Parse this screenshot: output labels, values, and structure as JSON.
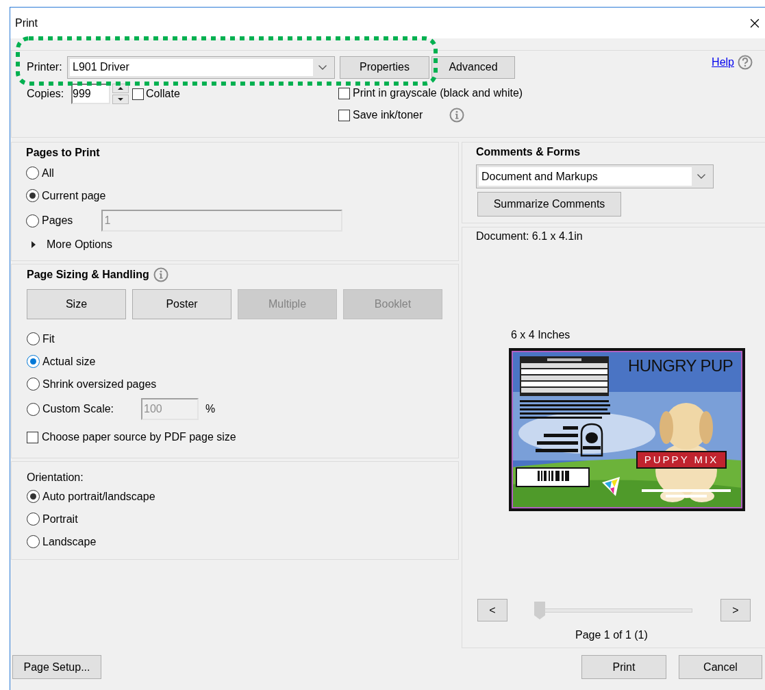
{
  "window": {
    "title": "Print"
  },
  "printer": {
    "label": "Printer:",
    "value": "L901 Driver"
  },
  "top_buttons": [
    {
      "label": "Properties"
    },
    {
      "label": "Advanced"
    }
  ],
  "help": {
    "label": "Help"
  },
  "copies": {
    "label": "Copies:",
    "value": "999"
  },
  "collate": {
    "label": "Collate",
    "checked": false
  },
  "print_options": [
    {
      "label": "Print in grayscale (black and white)",
      "checked": false,
      "kind": "plain"
    },
    {
      "label": "Save ink/toner",
      "checked": false,
      "kind": "info"
    }
  ],
  "pages_to_print": {
    "title": "Pages to Print",
    "options": [
      {
        "label": "All",
        "selected": false
      },
      {
        "label": "Current page",
        "selected": true
      },
      {
        "label": "Pages",
        "selected": false,
        "field": {
          "value": "1",
          "disabled": true
        }
      }
    ],
    "more_options": {
      "label": "More Options",
      "expanded": false
    }
  },
  "page_sizing": {
    "title": "Page Sizing & Handling",
    "modes": [
      {
        "label": "Size",
        "disabled": false
      },
      {
        "label": "Poster",
        "disabled": false
      },
      {
        "label": "Multiple",
        "disabled": true
      },
      {
        "label": "Booklet",
        "disabled": true
      }
    ],
    "options": [
      {
        "label": "Fit",
        "selected": false,
        "focused": false
      },
      {
        "label": "Actual size",
        "selected": true,
        "focused": true
      },
      {
        "label": "Shrink oversized pages",
        "selected": false,
        "focused": false
      },
      {
        "label": "Custom Scale:",
        "selected": false,
        "focused": false,
        "field": {
          "value": "100",
          "disabled": true
        },
        "unit": "%"
      }
    ],
    "paper_source": {
      "label": "Choose paper source by PDF page size",
      "checked": false
    }
  },
  "orientation": {
    "title": "Orientation:",
    "options": [
      {
        "label": "Auto portrait/landscape",
        "selected": true
      },
      {
        "label": "Portrait",
        "selected": false
      },
      {
        "label": "Landscape",
        "selected": false
      }
    ]
  },
  "comments_forms": {
    "title": "Comments & Forms",
    "value": "Document and Markups",
    "button": "Summarize Comments"
  },
  "preview": {
    "document_size": "Document: 6.1 x 4.1in",
    "page_size": "6 x 4 Inches",
    "label_title": "HUNGRY PUP",
    "label_banner": "PUPPY MIX",
    "prev": "<",
    "next": ">",
    "slider": {
      "level": 0
    },
    "page_info": "Page 1 of 1 (1)"
  },
  "footer": {
    "page_setup": "Page Setup...",
    "print": "Print",
    "cancel": "Cancel"
  }
}
